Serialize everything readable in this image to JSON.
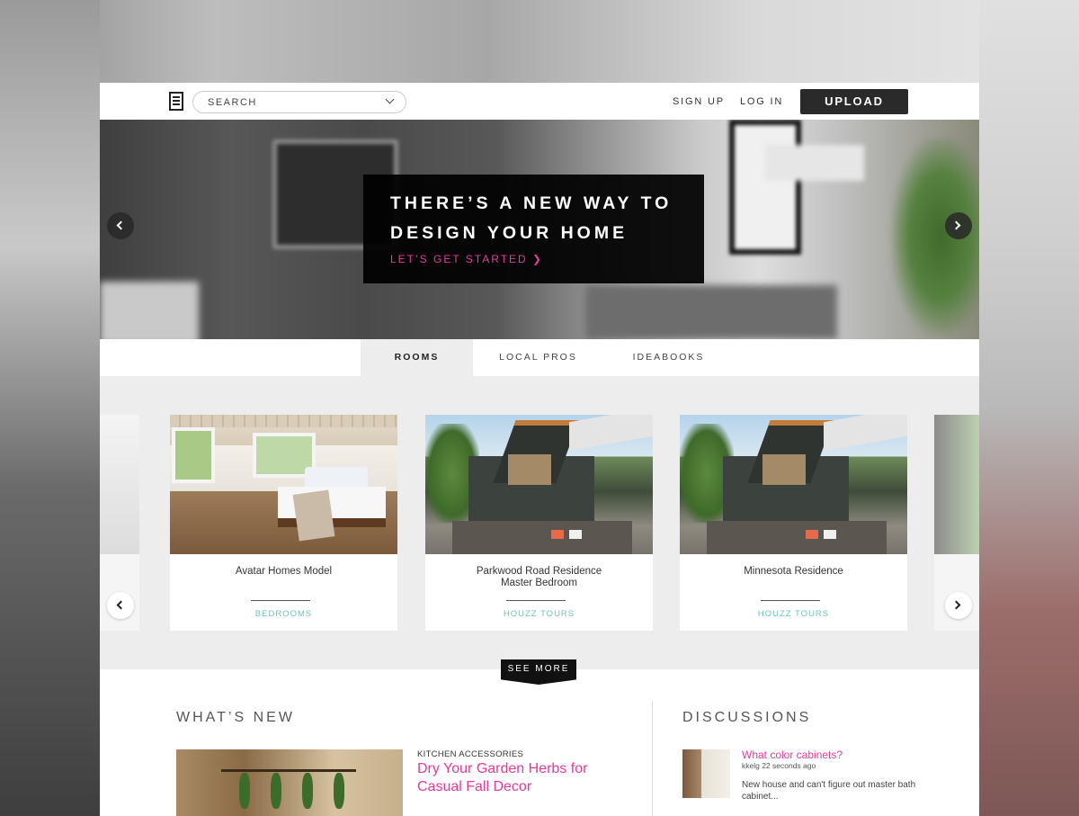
{
  "header": {
    "search_placeholder": "SEARCH",
    "sign_up": "SIGN UP",
    "log_in": "LOG IN",
    "upload": "UPLOAD"
  },
  "hero": {
    "title": "THERE’S A NEW WAY TO DESIGN YOUR HOME",
    "cta": "LET’S GET STARTED ❯"
  },
  "tabs": [
    {
      "label": "ROOMS",
      "active": true
    },
    {
      "label": "LOCAL PROS",
      "active": false
    },
    {
      "label": "IDEABOOKS",
      "active": false
    }
  ],
  "cards": [
    {
      "title": "Avatar Homes Model",
      "tag": "BEDROOMS",
      "image": "bedroom-photo"
    },
    {
      "title": "Parkwood Road Residence\nMaster Bedroom",
      "tag": "HOUZZ TOURS",
      "image": "modern-house-photo"
    },
    {
      "title": "Minnesota Residence",
      "tag": "HOUZZ TOURS",
      "image": "modern-house-photo"
    }
  ],
  "see_more": "SEE MORE",
  "whats_new": {
    "heading": "WHAT’S NEW",
    "category": "KITCHEN ACCESSORIES",
    "title": "Dry Your Garden Herbs for Casual Fall Decor"
  },
  "discussions": {
    "heading": "DISCUSSIONS",
    "title": "What color cabinets?",
    "meta": "kkelg 22 seconds ago",
    "body": "New house and can't figure out master bath cabinet..."
  },
  "colors": {
    "accent_pink": "#e6399b",
    "teal": "#6cc3b8",
    "dark": "#2a2a2a"
  }
}
